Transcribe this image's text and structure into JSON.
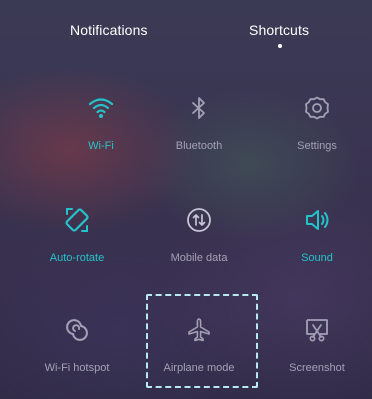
{
  "tabs": {
    "notifications": "Notifications",
    "shortcuts": "Shortcuts"
  },
  "shortcuts": [
    {
      "label": "Wi-Fi",
      "icon": "wifi-icon",
      "active": true
    },
    {
      "label": "Bluetooth",
      "icon": "bluetooth-icon",
      "active": false
    },
    {
      "label": "Settings",
      "icon": "gear-icon",
      "active": false
    },
    {
      "label": "Auto-rotate",
      "icon": "auto-rotate-icon",
      "active": true
    },
    {
      "label": "Mobile data",
      "icon": "mobile-data-icon",
      "active": false
    },
    {
      "label": "Sound",
      "icon": "speaker-icon",
      "active": true
    },
    {
      "label": "Wi-Fi hotspot",
      "icon": "hotspot-icon",
      "active": false
    },
    {
      "label": "Airplane mode",
      "icon": "airplane-icon",
      "active": false
    },
    {
      "label": "Screenshot",
      "icon": "screenshot-icon",
      "active": false
    }
  ],
  "colors": {
    "active": "#24c3c9",
    "inactive": "#a3a1b6",
    "highlight_border": "#b7eaf0"
  }
}
